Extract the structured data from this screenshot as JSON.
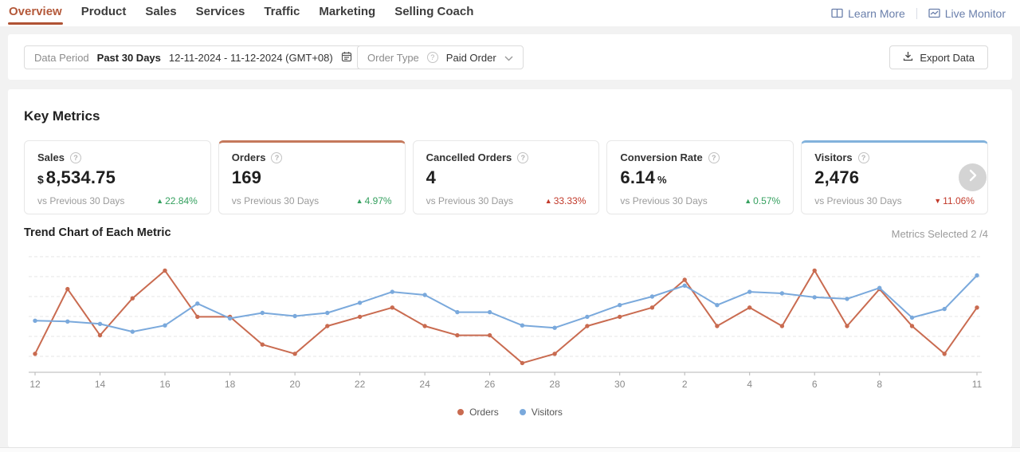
{
  "nav": {
    "tabs": [
      {
        "label": "Overview",
        "active": true
      },
      {
        "label": "Product",
        "active": false
      },
      {
        "label": "Sales",
        "active": false
      },
      {
        "label": "Services",
        "active": false
      },
      {
        "label": "Traffic",
        "active": false
      },
      {
        "label": "Marketing",
        "active": false
      },
      {
        "label": "Selling Coach",
        "active": false
      }
    ],
    "links": [
      {
        "label": "Learn More",
        "icon": "book-icon"
      },
      {
        "label": "Live Monitor",
        "icon": "monitor-chart-icon"
      }
    ]
  },
  "filters": {
    "data_period_label": "Data Period",
    "period_preset": "Past 30 Days",
    "period_range": "12-11-2024 - 11-12-2024 (GMT+08)",
    "calendar_icon": "calendar-icon",
    "order_type_label": "Order Type",
    "order_type_value": "Paid Order",
    "export_label": "Export Data",
    "export_icon": "download-icon"
  },
  "key_metrics": {
    "title": "Key Metrics",
    "compare_label": "vs Previous 30 Days",
    "cards": [
      {
        "label": "Sales",
        "prefix": "$",
        "value": "8,534.75",
        "suffix": "",
        "delta": "22.84%",
        "direction": "up",
        "delta_color": "#35a05f",
        "accent_color": ""
      },
      {
        "label": "Orders",
        "prefix": "",
        "value": "169",
        "suffix": "",
        "delta": "4.97%",
        "direction": "up",
        "delta_color": "#35a05f",
        "accent_color": "#c5795c"
      },
      {
        "label": "Cancelled Orders",
        "prefix": "",
        "value": "4",
        "suffix": "",
        "delta": "33.33%",
        "direction": "up",
        "delta_color": "#c23a2b",
        "accent_color": ""
      },
      {
        "label": "Conversion Rate",
        "prefix": "",
        "value": "6.14",
        "suffix": "%",
        "delta": "0.57%",
        "direction": "up",
        "delta_color": "#35a05f",
        "accent_color": ""
      },
      {
        "label": "Visitors",
        "prefix": "",
        "value": "2,476",
        "suffix": "",
        "delta": "11.06%",
        "direction": "down",
        "delta_color": "#c23a2b",
        "accent_color": "#82b2dc"
      }
    ]
  },
  "trend": {
    "title": "Trend Chart of Each Metric",
    "metrics_selected": "Metrics Selected 2 /4"
  },
  "chart_data": {
    "type": "line",
    "title": "Trend Chart of Each Metric",
    "categories": [
      "12",
      "13",
      "14",
      "15",
      "16",
      "17",
      "18",
      "19",
      "20",
      "21",
      "22",
      "23",
      "24",
      "25",
      "26",
      "27",
      "28",
      "29",
      "30",
      "1",
      "2",
      "3",
      "4",
      "5",
      "6",
      "7",
      "8",
      "9",
      "10",
      "11"
    ],
    "tick_indices": [
      0,
      2,
      4,
      6,
      8,
      10,
      12,
      14,
      16,
      18,
      20,
      22,
      24,
      26,
      29
    ],
    "grid": true,
    "legend_position": "bottom",
    "series": [
      {
        "name": "Orders",
        "color": "#c96b50",
        "ylim": [
          0,
          12.5
        ],
        "values": [
          2,
          9,
          4,
          8,
          11,
          6,
          6,
          3,
          2,
          5,
          6,
          7,
          5,
          4,
          4,
          1,
          2,
          5,
          6,
          7,
          10,
          5,
          7,
          5,
          11,
          5,
          9,
          5,
          2,
          7
        ]
      },
      {
        "name": "Visitors",
        "color": "#7aa9dc",
        "ylim": [
          0,
          148
        ],
        "values": [
          66,
          65,
          62,
          52,
          60,
          88,
          69,
          76,
          72,
          76,
          89,
          103,
          99,
          77,
          77,
          60,
          57,
          71,
          86,
          97,
          111,
          86,
          103,
          101,
          96,
          94,
          108,
          70,
          81,
          124
        ]
      }
    ]
  }
}
